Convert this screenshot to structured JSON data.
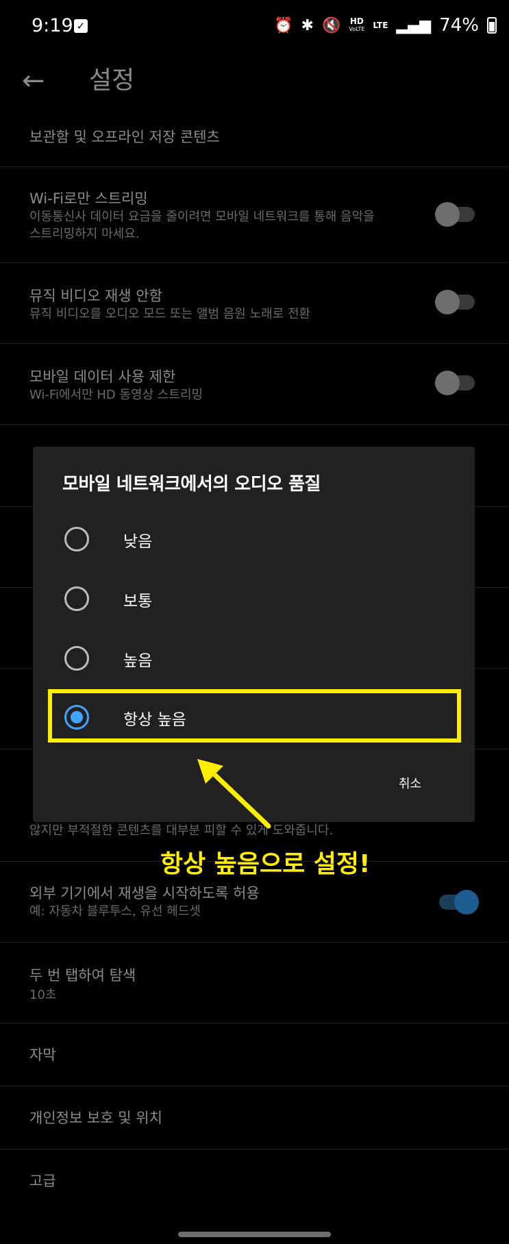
{
  "status_bar": {
    "time": "9:19",
    "network": "HD",
    "network_sub": "VoLTE",
    "lte": "LTE",
    "battery": "74%",
    "icons": [
      "alarm-icon",
      "bluetooth-icon",
      "mute-icon",
      "signal-icon",
      "battery-icon"
    ]
  },
  "header": {
    "title": "설정"
  },
  "settings": [
    {
      "title": "보관함 및 오프라인 저장 콘텐츠"
    },
    {
      "title": "Wi-Fi로만 스트리밍",
      "subtitle": "이동통신사 데이터 요금을 줄이려면 모바일 네트워크를 통해 음악을 스트리밍하지 마세요."
    },
    {
      "title": "뮤직 비디오 재생 안함",
      "subtitle": "뮤직 비디오를 오디오 모드 또는 앨범 음원 노래로 전환"
    },
    {
      "title": "모바일 데이터 사용 제한",
      "subtitle": "Wi-Fi에서만 HD 동영상 스트리밍"
    },
    {
      "partial_subtitle": "않지만 부적절한 콘텐츠를 대부분 피할 수 있게 도와줍니다."
    },
    {
      "title": "외부 기기에서 재생을 시작하도록 허용",
      "subtitle": "예: 자동차 블루투스, 유선 헤드셋"
    },
    {
      "title": "두 번 탭하여 탐색",
      "subtitle": "10초"
    },
    {
      "title": "자막"
    },
    {
      "title": "개인정보 보호 및 위치"
    },
    {
      "title": "고급"
    }
  ],
  "dialog": {
    "title": "모바일 네트워크에서의 오디오 품질",
    "options": [
      "낮음",
      "보통",
      "높음",
      "항상 높음"
    ],
    "selected_index": 3,
    "cancel_label": "취소"
  },
  "annotation": {
    "text": "항상 높음으로 설정!"
  },
  "colors": {
    "accent": "#3ea6ff",
    "highlight": "#ffee00",
    "dialog_bg": "#212121"
  }
}
